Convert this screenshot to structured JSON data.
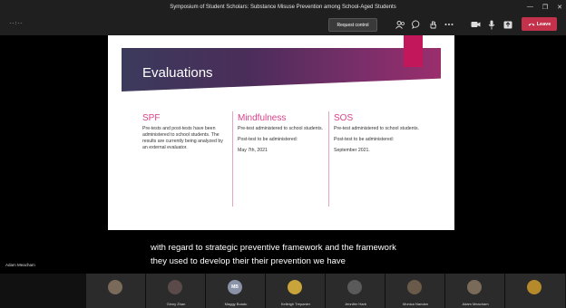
{
  "window": {
    "title": "Symposium of Student Scholars: Substance Misuse Prevention among School-Aged Students",
    "controls": [
      "—",
      "❐",
      "✕"
    ]
  },
  "toolbar": {
    "timer": "--:--",
    "request_control": "Request control",
    "leave": "Leave",
    "icons": [
      "people-icon",
      "chat-icon",
      "raise-hand-icon",
      "more-icon",
      "camera-icon",
      "mic-icon",
      "share-icon"
    ]
  },
  "slide": {
    "title": "Evaluations",
    "columns": [
      {
        "heading": "SPF",
        "paragraphs": [
          "Pre-tests and post-tests have been administered to school students.  The results are currently being analyzed by an external evaluator."
        ]
      },
      {
        "heading": "Mindfulness",
        "paragraphs": [
          "Pre-test administered to school students.",
          "Post-test to be administered:",
          "May 7th, 2021"
        ]
      },
      {
        "heading": "SOS",
        "paragraphs": [
          "Pre-test administered to school students.",
          "Post-test to be administered:",
          "September 2021."
        ]
      }
    ],
    "colors": {
      "band_start": "#3b3a5c",
      "band_end": "#9a2e6c",
      "accent": "#c2185b",
      "heading": "#d9418a"
    }
  },
  "caption": {
    "line1": "with regard to strategic preventive framework and the framework",
    "line2": "they used to develop their their prevention we have"
  },
  "speaker": {
    "name": "Adam Meacham"
  },
  "participants": [
    {
      "name": "",
      "initials": "",
      "color": "#7a6a5a"
    },
    {
      "name": "Ginny Zhan",
      "initials": "",
      "color": "#5a4a4a"
    },
    {
      "name": "Maggy Boadu",
      "initials": "MB",
      "color": "#8a93a8"
    },
    {
      "name": "Kelleigh Trepanier",
      "initials": "",
      "color": "#c9a43a"
    },
    {
      "name": "Jennifer Harb",
      "initials": "",
      "color": "#5a5a5a"
    },
    {
      "name": "Monica Nandan",
      "initials": "",
      "color": "#6a5a4a"
    },
    {
      "name": "Adam Meacham",
      "initials": "",
      "color": "#7a6a5a"
    },
    {
      "name": "",
      "initials": "",
      "color": "#b58a2a"
    }
  ]
}
